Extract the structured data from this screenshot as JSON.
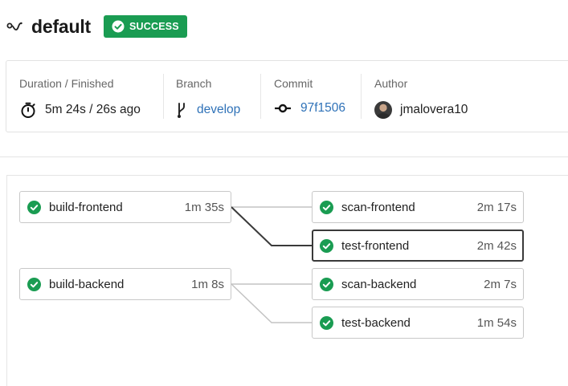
{
  "header": {
    "title": "default",
    "status": "SUCCESS",
    "status_color": "#1a9c52"
  },
  "meta": {
    "duration_label": "Duration / Finished",
    "duration_value": "5m 24s / 26s ago",
    "branch_label": "Branch",
    "branch_value": "develop",
    "commit_label": "Commit",
    "commit_value": "97f1506",
    "author_label": "Author",
    "author_value": "jmalovera10"
  },
  "steps": {
    "build_frontend": {
      "name": "build-frontend",
      "duration": "1m 35s"
    },
    "build_backend": {
      "name": "build-backend",
      "duration": "1m 8s"
    },
    "scan_frontend": {
      "name": "scan-frontend",
      "duration": "2m 17s"
    },
    "test_frontend": {
      "name": "test-frontend",
      "duration": "2m 42s"
    },
    "scan_backend": {
      "name": "scan-backend",
      "duration": "2m 7s"
    },
    "test_backend": {
      "name": "test-backend",
      "duration": "1m 54s"
    }
  },
  "colors": {
    "success": "#1a9c52",
    "link": "#2f72b8"
  }
}
